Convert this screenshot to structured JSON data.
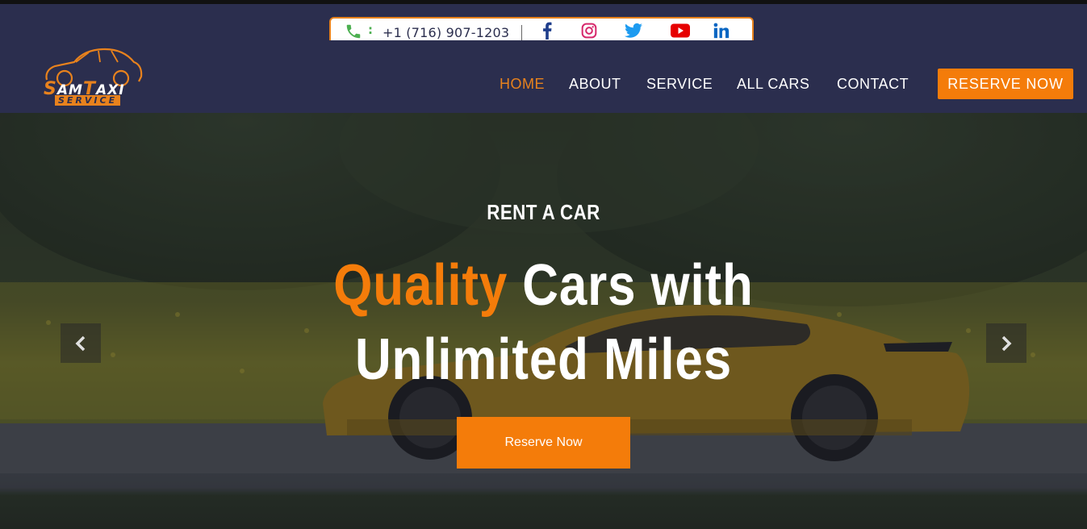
{
  "contact": {
    "phone": "+1 (716) 907-1203",
    "separator": ":",
    "socials": [
      "facebook-icon",
      "instagram-icon",
      "twitter-icon",
      "youtube-icon",
      "linkedin-icon"
    ]
  },
  "logo": {
    "text": "SAMTAXI",
    "sub": "SERVICE"
  },
  "nav": {
    "items": [
      {
        "label": "HOME",
        "active": true
      },
      {
        "label": "ABOUT"
      },
      {
        "label": "SERVICE"
      },
      {
        "label": "ALL CARS"
      },
      {
        "label": "CONTACT"
      }
    ],
    "reserve_label": "RESERVE NOW"
  },
  "hero": {
    "eyebrow": "RENT A CAR",
    "headline_accent": "Quality",
    "headline_rest": "Cars with",
    "headline_line2": "Unlimited Miles",
    "cta_label": "Reserve Now"
  },
  "colors": {
    "header_bg": "#2b2e4e",
    "accent": "#f47c0a",
    "text": "#ffffff"
  }
}
